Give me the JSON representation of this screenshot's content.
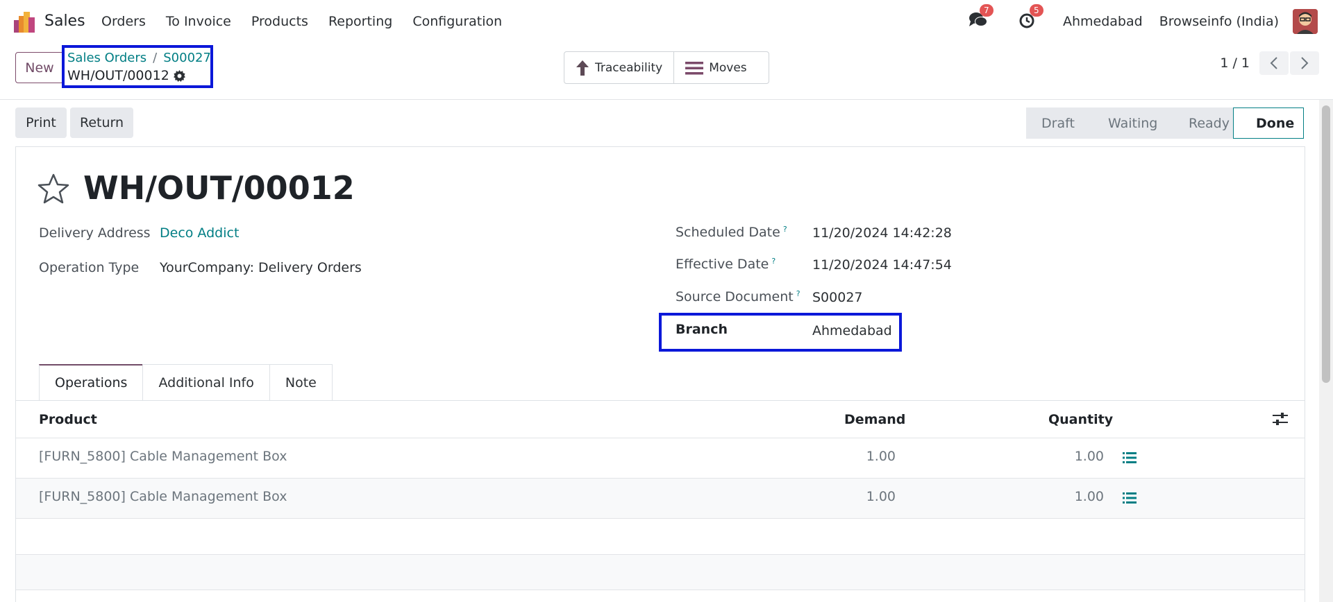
{
  "navbar": {
    "app_name": "Sales",
    "menu": [
      "Orders",
      "To Invoice",
      "Products",
      "Reporting",
      "Configuration"
    ],
    "messages_count": "7",
    "activities_count": "5",
    "branch": "Ahmedabad",
    "company": "Browseinfo (India)"
  },
  "control": {
    "new_label": "New",
    "breadcrumb": {
      "parent": "Sales Orders",
      "separator": "/",
      "order": "S00027",
      "current": "WH/OUT/00012"
    },
    "smart_buttons": {
      "traceability": "Traceability",
      "moves": "Moves"
    },
    "pager": "1 / 1"
  },
  "actions": {
    "print": "Print",
    "return": "Return"
  },
  "statusbar": [
    "Draft",
    "Waiting",
    "Ready",
    "Done"
  ],
  "record": {
    "title": "WH/OUT/00012",
    "delivery_address_label": "Delivery Address",
    "delivery_address": "Deco Addict",
    "operation_type_label": "Operation Type",
    "operation_type": "YourCompany: Delivery Orders",
    "scheduled_date_label": "Scheduled Date",
    "scheduled_date": "11/20/2024 14:42:28",
    "effective_date_label": "Effective Date",
    "effective_date": "11/20/2024 14:47:54",
    "source_document_label": "Source Document",
    "source_document": "S00027",
    "branch_label": "Branch",
    "branch": "Ahmedabad",
    "help_mark": "?"
  },
  "tabs": [
    "Operations",
    "Additional Info",
    "Note"
  ],
  "table": {
    "headers": {
      "product": "Product",
      "demand": "Demand",
      "quantity": "Quantity"
    },
    "rows": [
      {
        "product": "[FURN_5800] Cable Management Box",
        "demand": "1.00",
        "quantity": "1.00"
      },
      {
        "product": "[FURN_5800] Cable Management Box",
        "demand": "1.00",
        "quantity": "1.00"
      }
    ]
  },
  "colors": {
    "primary": "#714B67",
    "link": "#017e84",
    "highlight_box": "#0b18d9",
    "badge": "#e35454"
  }
}
